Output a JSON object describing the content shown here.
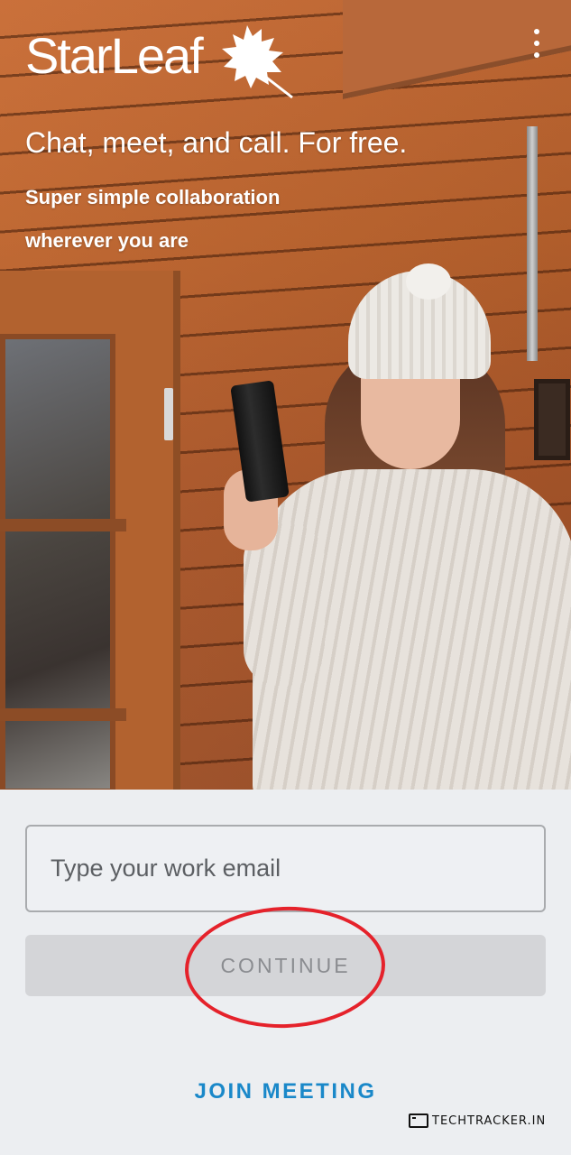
{
  "hero": {
    "brand_name": "StarLeaf",
    "tagline": "Chat, meet, and call. For free.",
    "subline_1": "Super simple collaboration",
    "subline_2": "wherever you are",
    "logo_icon": "leaf-icon",
    "menu_icon": "more-vert-icon"
  },
  "form": {
    "email_placeholder": "Type your work email",
    "email_value": "",
    "continue_label": "CONTINUE",
    "join_label": "JOIN MEETING"
  },
  "watermark": {
    "text": "TECHTRACKER.IN"
  },
  "colors": {
    "link": "#1a88c9",
    "button_disabled_bg": "#d4d5d8",
    "button_disabled_text": "#8a8c90",
    "annotation": "#e5222b",
    "background": "#eceef1"
  }
}
